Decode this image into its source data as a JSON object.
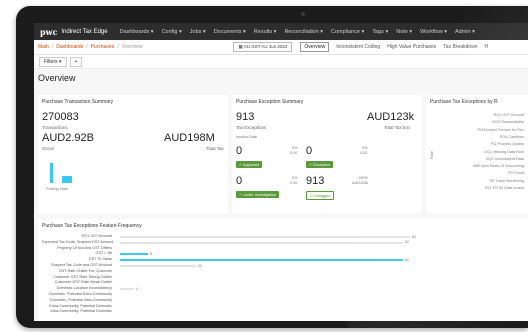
{
  "nav": {
    "logo": "pwc",
    "app_name": "Indirect Tax Edge",
    "items": [
      "Dashboards ▾",
      "Config ▾",
      "Jobs ▾",
      "Documents ▾",
      "Results ▾",
      "Reconciliation ▾",
      "Compliance ▾",
      "Tags ▾",
      "Note ▾",
      "Workflow ▾",
      "Admin ▾"
    ]
  },
  "breadcrumb": {
    "items": [
      "Main",
      "Dashboards",
      "Purchases",
      "Overview"
    ],
    "sep": "/"
  },
  "period": "AU GST AU Jun 2022",
  "subtabs": [
    "Overview",
    "Inconsistent Coding",
    "High Value Purchases",
    "Tax Breakdown",
    "H"
  ],
  "filters": {
    "label": "Filters ▾",
    "add": "+"
  },
  "page_title": "Overview",
  "transaction_summary": {
    "title": "Purchase Transaction Summary",
    "transactions_value": "270083",
    "transactions_label": "Transactions",
    "gross_value": "AUD2.92B",
    "gross_label": "Gross",
    "tax_value": "AUD198M",
    "tax_label": "Total Tax",
    "posting_label": "Posting Date",
    "posting_bars": [
      0.9,
      0.3
    ]
  },
  "exception_summary": {
    "title": "Purchase Exception Summary",
    "exceptions_value": "913",
    "exceptions_label": "Tax Exceptions",
    "tax_value": "AUD123k",
    "tax_label": "Total Tax Exc",
    "invoice_label": "Invoice Date",
    "boxes": [
      {
        "count": "0",
        "pct": "0%",
        "amount": "0.00",
        "status": "Approved"
      },
      {
        "count": "0",
        "pct": "0%",
        "amount": "0.00",
        "status": "Exception"
      },
      {
        "count": "0",
        "pct": "0%",
        "amount": "0.00",
        "status": "Under Investigation"
      },
      {
        "count": "913",
        "pct": "100%",
        "amount": "AUD123k",
        "status": "Untagged"
      }
    ]
  },
  "exceptions_by_rule": {
    "title": "Purchase Tax Exceptions by R",
    "axis_label": "Rule",
    "rules": [
      "RO1 GST Amount",
      "RO2 Reasonability",
      "RO3 Import Service for Rev",
      "RO4 Cashflow",
      "PQ Process Quality",
      "DQ1 Missing Data Rule",
      "DQ2 Inconsistent Data",
      "NBA New Basis Of Accounting",
      "FR Fraud",
      "TM Trade Monitoring",
      "SV1 ES 54 Data invalid"
    ]
  },
  "feature_frequency": {
    "title": "Purchase Tax Exceptions Feature Frequency",
    "rows": [
      {
        "label": "RO1 GST Amount",
        "value": 84,
        "highlight": false
      },
      {
        "label": "Expected Tax Code, Suspect GST Amount",
        "value": 82,
        "highlight": false
      },
      {
        "label": "Property Of Not And GST Differs",
        "value": null,
        "highlight": false
      },
      {
        "label": "GST = Nil",
        "value": 8,
        "highlight": true
      },
      {
        "label": "GST To Value",
        "value": 82,
        "highlight": true
      },
      {
        "label": "Suspect Tax Code and GST Amount",
        "value": 22,
        "highlight": false
      },
      {
        "label": "GST Rate Outlier For Customer",
        "value": null,
        "highlight": false
      },
      {
        "label": "Customer GST Rate Strong Outlier",
        "value": null,
        "highlight": false
      },
      {
        "label": "Customer GST Rate Weak Outlier",
        "value": null,
        "highlight": false
      },
      {
        "label": "Domestic Location Inconsistency",
        "value": 4,
        "highlight": false
      },
      {
        "label": "Domestic, Potential Extra Community",
        "value": null,
        "highlight": false
      },
      {
        "label": "Domestic, Potential Intra-Community",
        "value": null,
        "highlight": false
      },
      {
        "label": "Extra-Community, Potential Domestic",
        "value": null,
        "highlight": false
      },
      {
        "label": "Intra-Community, Potential Domestic",
        "value": null,
        "highlight": false
      }
    ],
    "max": 84
  }
}
